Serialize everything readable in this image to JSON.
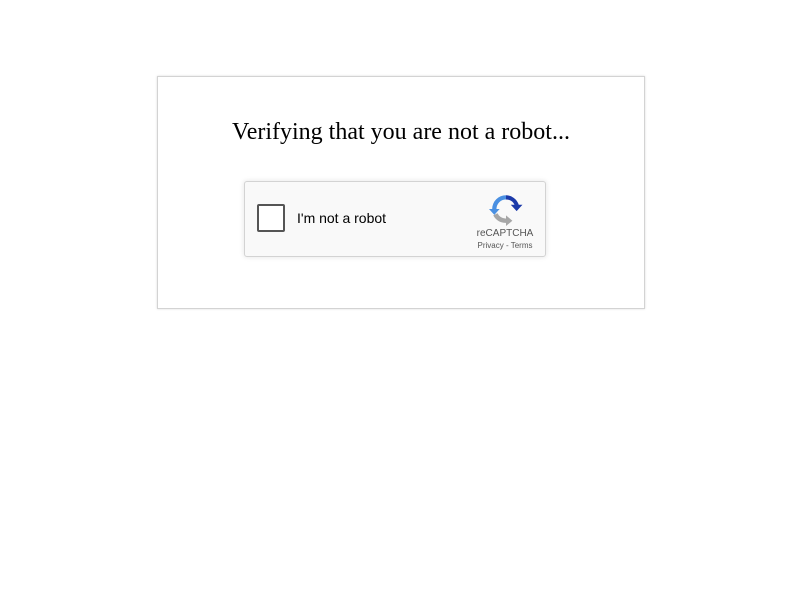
{
  "page": {
    "heading": "Verifying that you are not a robot..."
  },
  "recaptcha": {
    "checkbox_label": "I'm not a robot",
    "brand": "reCAPTCHA",
    "privacy_link": "Privacy",
    "separator": "-",
    "terms_link": "Terms",
    "checked": false,
    "logo_icon": "recaptcha-logo-icon",
    "colors": {
      "logo_blue_dark": "#1c3aa9",
      "logo_blue_light": "#4a90e2",
      "logo_gray": "#a6a6a6",
      "widget_bg": "#f9f9f9",
      "widget_border": "#d3d3d3"
    }
  }
}
